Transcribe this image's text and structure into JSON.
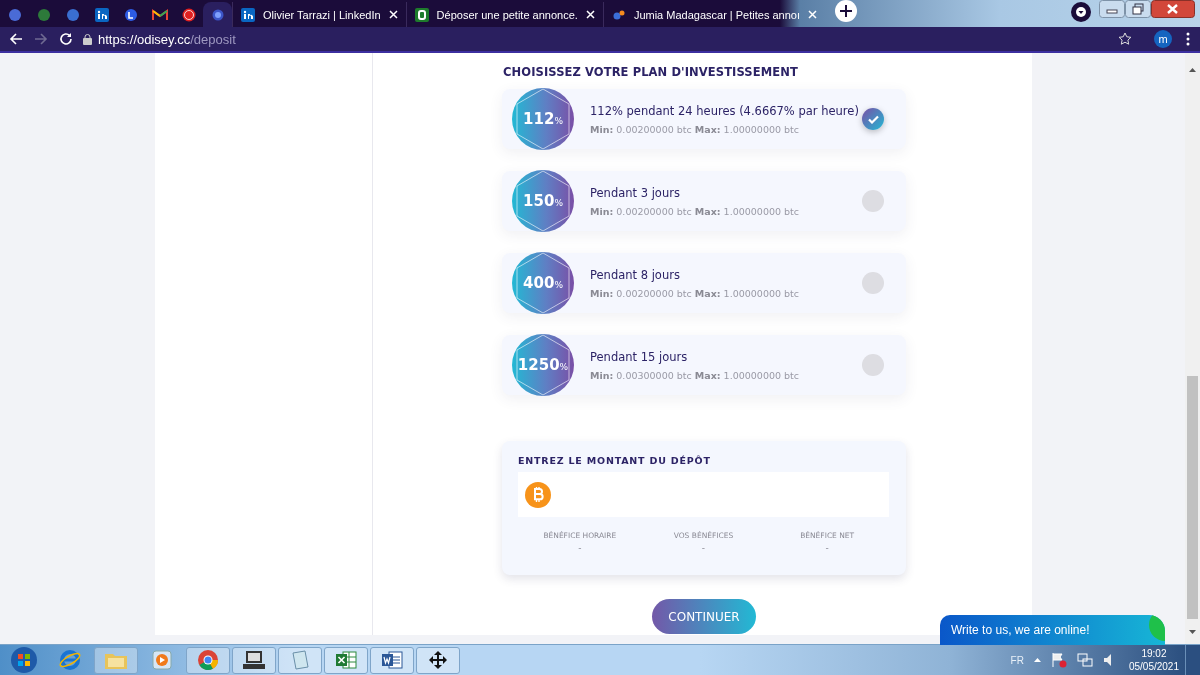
{
  "browser": {
    "tabs": [
      {
        "kind": "pinned",
        "selected": false
      },
      {
        "kind": "pinned",
        "selected": false
      },
      {
        "kind": "pinned",
        "selected": false
      },
      {
        "kind": "pinned",
        "selected": false
      },
      {
        "kind": "pinned",
        "selected": false
      },
      {
        "kind": "pinned",
        "selected": false
      },
      {
        "kind": "pinned",
        "selected": false
      },
      {
        "kind": "pinned",
        "selected": true
      },
      {
        "kind": "page",
        "title": "Olivier Tarrazi | LinkedIn",
        "selected": false
      },
      {
        "kind": "page",
        "title": "Déposer une petite annonce.",
        "selected": false
      },
      {
        "kind": "page",
        "title": "Jumia Madagascar | Petites annoı",
        "selected": false
      }
    ],
    "address": {
      "host": "https://odisey.cc",
      "path": "/deposit"
    },
    "profile": "m"
  },
  "heading": "CHOISISSEZ VOTRE PLAN D'INVESTISSEMENT",
  "plans": [
    {
      "rate": "112",
      "unit": "%",
      "title": "112% pendant 24 heures (4.6667% par heure)",
      "min_label": "Min:",
      "min": "0.00200000 btc",
      "max_label": "Max:",
      "max": "1.00000000 btc",
      "selected": true
    },
    {
      "rate": "150",
      "unit": "%",
      "title": "Pendant 3 jours",
      "min_label": "Min:",
      "min": "0.00200000 btc",
      "max_label": "Max:",
      "max": "1.00000000 btc",
      "selected": false
    },
    {
      "rate": "400",
      "unit": "%",
      "title": "Pendant 8 jours",
      "min_label": "Min:",
      "min": "0.00200000 btc",
      "max_label": "Max:",
      "max": "1.00000000 btc",
      "selected": false
    },
    {
      "rate": "1250",
      "unit": "%",
      "title": "Pendant 15 jours",
      "min_label": "Min:",
      "min": "0.00300000 btc",
      "max_label": "Max:",
      "max": "1.00000000 btc",
      "selected": false
    }
  ],
  "deposit": {
    "label": "ENTREZ LE MONTANT DU DÉPÔT",
    "stats": [
      {
        "label": "BÉNÉFICE HORAIRE",
        "value": "-"
      },
      {
        "label": "VOS BÉNÉFICES",
        "value": "-"
      },
      {
        "label": "BÉNÉFICE NET",
        "value": "-"
      }
    ]
  },
  "continue_button": "CONTINUER",
  "chat": "Write to us, we are online!",
  "taskbar": {
    "language": "FR",
    "time": "19:02",
    "date": "05/05/2021"
  }
}
